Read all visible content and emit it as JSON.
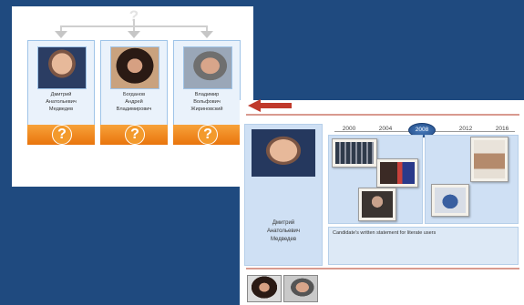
{
  "left_panel": {
    "top_symbol": "?",
    "cards": [
      {
        "name": "Дмитрий\nАнатольевич\nМедведев",
        "badge": "?"
      },
      {
        "name": "Богданов\nАндрей\nВладимирович",
        "badge": "?"
      },
      {
        "name": "Владимир\nВольфович\nЖириновский",
        "badge": "?"
      }
    ]
  },
  "right_panel": {
    "profile_name": "Дмитрий\nАнатольевич\nМедведев",
    "timeline_years": [
      "2000",
      "2004",
      "2008",
      "2012",
      "2016"
    ],
    "highlighted_year": "2008",
    "statement_text": "Candidate's written statement for literate users"
  },
  "colors": {
    "background": "#1f4a7f",
    "accent_orange": "#f39a2c",
    "arrow_red": "#c0392b",
    "card_blue": "#cfe0f4"
  }
}
